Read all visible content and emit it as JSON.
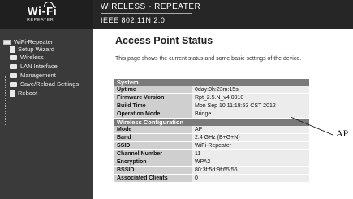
{
  "header": {
    "logo_text": "Wi-Fi",
    "logo_sub": "REPEATER",
    "title": "WIRELESS - REPEATER",
    "subtitle": "IEEE 802.11N 2.0"
  },
  "sidebar": {
    "root": "WiFi-Repeater",
    "items": [
      {
        "label": "Setup Wizard"
      },
      {
        "label": "Wireless"
      },
      {
        "label": "LAN Interface"
      },
      {
        "label": "Management"
      },
      {
        "label": "Save/Reload Settings"
      },
      {
        "label": "Reboot"
      }
    ]
  },
  "main": {
    "title": "Access Point Status",
    "description": "This page shows the current status and some basic settings of the device.",
    "system": {
      "header": "System",
      "rows": [
        {
          "key": "Uptime",
          "value": "0day:0h:23m:15s"
        },
        {
          "key": "Firmware Version",
          "value": "Rpt_2.5.N_v4.0910"
        },
        {
          "key": "Build Time",
          "value": "Mon Sep 10 11:18:53 CST 2012"
        },
        {
          "key": "Operation Mode",
          "value": "Bridge"
        }
      ]
    },
    "wireless": {
      "header": "Wireless Configuration",
      "rows": [
        {
          "key": "Mode",
          "value": "AP"
        },
        {
          "key": "Band",
          "value": "2.4 GHz (B+G+N)"
        },
        {
          "key": "SSID",
          "value": "WiFi-Repeater"
        },
        {
          "key": "Channel Number",
          "value": "11"
        },
        {
          "key": "Encryption",
          "value": "WPA2"
        },
        {
          "key": "BSSID",
          "value": "80:3f:5d:9f:65:56"
        },
        {
          "key": "Associated Clients",
          "value": "0"
        }
      ]
    }
  },
  "annotation": {
    "label": "AP"
  }
}
